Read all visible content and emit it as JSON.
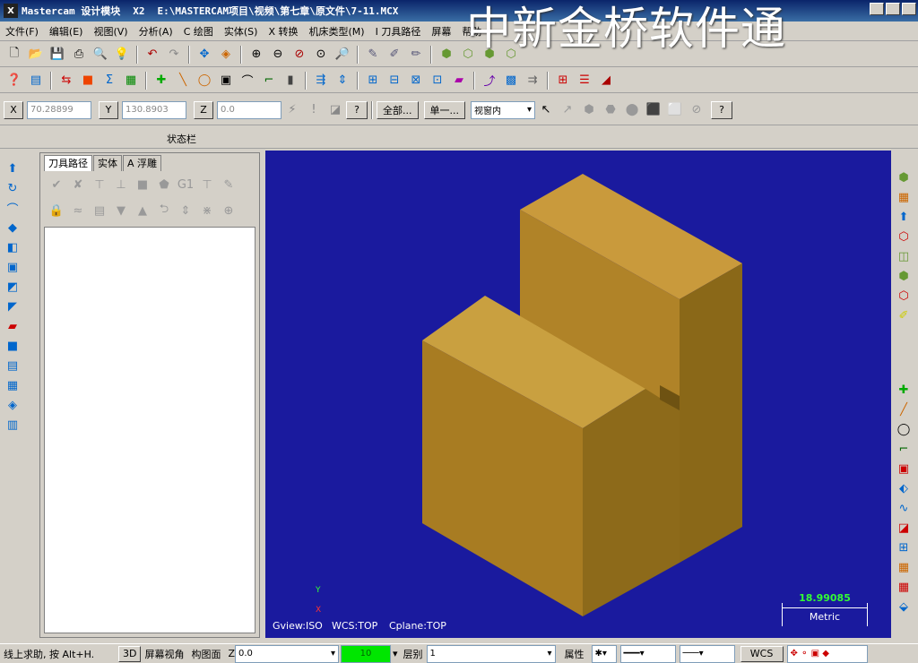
{
  "title": {
    "app": "Mastercam 设计模块",
    "version": "X2",
    "path": "E:\\MASTERCAM项目\\视频\\第七章\\原文件\\7-11.MCX"
  },
  "watermark": "中新金桥软件通",
  "menu": [
    "文件(F)",
    "编辑(E)",
    "视图(V)",
    "分析(A)",
    "C 绘图",
    "实体(S)",
    "X 转换",
    "机床类型(M)",
    "I 刀具路径",
    "屏幕",
    "帮助"
  ],
  "coords": {
    "x_label": "X",
    "x_value": "70.28899",
    "y_label": "Y",
    "y_value": "130.8903",
    "z_label": "Z",
    "z_value": "0.0"
  },
  "selection": {
    "all_label": "全部...",
    "single_label": "单一...",
    "window_select": "视窗内"
  },
  "status_bar_label": "状态栏",
  "manager_tabs": [
    "刀具路径",
    "实体",
    "A 浮雕"
  ],
  "viewport": {
    "gview": "Gview:ISO",
    "wcs": "WCS:TOP",
    "cplane": "Cplane:TOP",
    "axis_y": "Y",
    "axis_x": "X",
    "scale_value": "18.99085",
    "scale_unit": "Metric",
    "background_color": "#1a1a9e",
    "solid_color": "#c9a040"
  },
  "bottom": {
    "help": "线上求助, 按 Alt+H.",
    "mode_3d": "3D",
    "screen_view": "屏幕视角",
    "construct_plane": "构图面",
    "z_label": "Z",
    "z_value": "0.0",
    "level_value": "10",
    "layer_label": "层别",
    "layer_value": "1",
    "attributes": "属性",
    "wcs": "WCS"
  },
  "icons": {
    "toolbar_row1": [
      "new-file-icon",
      "open-file-icon",
      "save-icon",
      "print-icon",
      "print-preview-icon",
      "properties-icon",
      "undo-icon",
      "redo-icon",
      "select-icon",
      "zoom-window-icon",
      "zoom-icon",
      "zoom-out-icon",
      "zoom-prev-icon",
      "zoom-target-icon",
      "repaint-icon",
      "shading-icon",
      "wireframe-icon",
      "solid-box-icon",
      "solid-cyl-icon",
      "solid-cone-icon",
      "gradient-icon",
      "color-icon"
    ],
    "toolbar_row2": [
      "analysis-icon",
      "level-icon",
      "dimension-icon",
      "verify-icon",
      "sum-icon",
      "grid-icon",
      "point-icon",
      "line-icon",
      "circle-icon",
      "rectangle-icon",
      "spline-icon",
      "fillet-icon",
      "chamfer-icon",
      "xform-icon",
      "mirror-icon",
      "offset-icon",
      "rotate-icon",
      "scale-icon",
      "array-icon",
      "trim-icon",
      "break-icon",
      "join-icon",
      "toolpath-icon",
      "drill-icon",
      "contour-icon",
      "pocket-icon"
    ]
  }
}
